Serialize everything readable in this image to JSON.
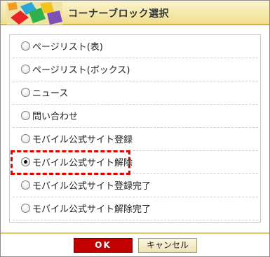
{
  "dialog": {
    "title": "コーナーブロック選択",
    "logo_icon": "colorful-blocks-logo-icon"
  },
  "options": [
    {
      "label": "ページリスト(表)",
      "checked": false
    },
    {
      "label": "ページリスト(ボックス)",
      "checked": false
    },
    {
      "label": "ニュース",
      "checked": false
    },
    {
      "label": "問い合わせ",
      "checked": false
    },
    {
      "label": "モバイル公式サイト登録",
      "checked": false
    },
    {
      "label": "モバイル公式サイト解除",
      "checked": true
    },
    {
      "label": "モバイル公式サイト登録完了",
      "checked": false
    },
    {
      "label": "モバイル公式サイト解除完了",
      "checked": false
    }
  ],
  "buttons": {
    "ok": "OK",
    "cancel": "キャンセル"
  },
  "colors": {
    "highlight": "#e00000",
    "ok_button": "#c30000",
    "title_bar": "#f0de8e"
  }
}
